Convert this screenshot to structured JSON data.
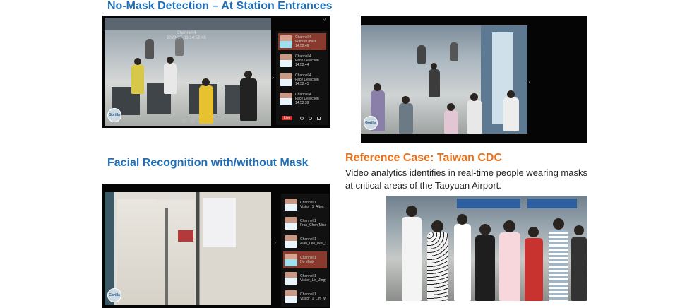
{
  "headings": {
    "no_mask": "No-Mask Detection – At Station Entrances",
    "facial": "Facial Recognition with/without Mask",
    "reference": "Reference Case: Taiwan CDC",
    "description": "Video analytics identifies in real-time people wearing masks at critical areas of the Taoyuan Airport."
  },
  "video1": {
    "osd_title": "Channel 4",
    "osd_time": "2020-07-03 14:52:48",
    "live_label": "Live",
    "logo_text": "Gorilla",
    "events": [
      {
        "channel": "Channel 4",
        "type": "Without mask",
        "time": "14:52:46",
        "face": "pink",
        "selected": true
      },
      {
        "channel": "Channel 4",
        "type": "Face Detection",
        "time": "14:52:44",
        "face": "light",
        "selected": false
      },
      {
        "channel": "Channel 4",
        "type": "Face Detection",
        "time": "14:52:41",
        "face": "light",
        "selected": false
      },
      {
        "channel": "Channel 4",
        "type": "Face Detection",
        "time": "14:52:39",
        "face": "light",
        "selected": false
      }
    ]
  },
  "video2": {
    "logo_text": "Gorilla"
  },
  "video3": {
    "osd_title": "Channel 1",
    "osd_time": "2020-05-18 15:16:47",
    "logo_text": "Gorilla",
    "events": [
      {
        "channel": "Channel 1",
        "type": "Visitor_1_Alton_Li",
        "face": "light",
        "selected": false
      },
      {
        "channel": "Channel 1",
        "type": "Fran_Chen(Miss_Chen)",
        "face": "light",
        "selected": false
      },
      {
        "channel": "Channel 1",
        "type": "Alan_Lee_Wei_Sun",
        "face": "light",
        "selected": false
      },
      {
        "channel": "Channel 1",
        "type": "No Mask",
        "face": "pink",
        "selected": true
      },
      {
        "channel": "Channel 1",
        "type": "Visitor_Lin_Jingyin",
        "face": "light",
        "selected": false
      },
      {
        "channel": "Channel 1",
        "type": "Visitor_1_Lim_Wayne_J",
        "face": "light",
        "selected": false
      }
    ]
  },
  "colors": {
    "heading_blue": "#1f6fb8",
    "heading_orange": "#e8711c",
    "selected_event": "#8a3a2c"
  }
}
